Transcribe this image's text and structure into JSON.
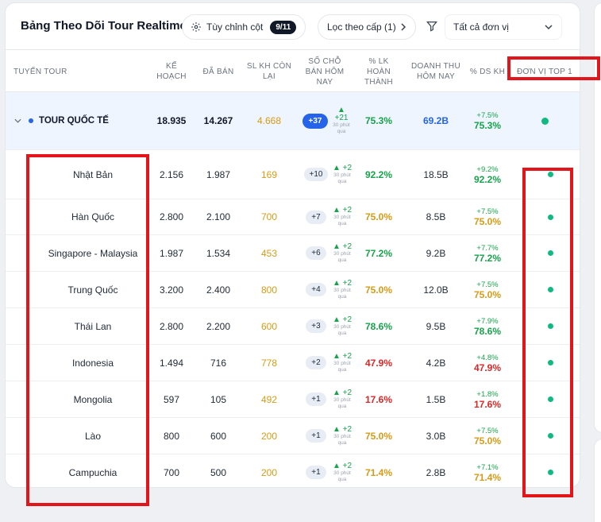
{
  "toolbar": {
    "title": "Bảng Theo Dõi Tour Realtime",
    "columns_button_label": "Tùy chỉnh cột",
    "columns_count": "9/11",
    "level_filter_label": "Lọc theo cấp (1)",
    "unit_select_value": "Tất cả đơn vị"
  },
  "columns": {
    "route": "TUYẾN TOUR",
    "plan": "KẾ HOẠCH",
    "sold": "ĐÃ BÁN",
    "remaining": "SL KH CÒN LẠI",
    "today": "SỐ CHỖ BÁN HÔM NAY",
    "completion": "% LK HOÀN THÀNH",
    "revenue": "DOANH THU HÔM NAY",
    "ds": "% DS KH",
    "top_unit": "ĐƠN VỊ TOP 1"
  },
  "total": {
    "name": "TOUR QUỐC TẾ",
    "plan": "18.935",
    "sold": "14.267",
    "remaining": "4.668",
    "today_pill": "+37",
    "today_delta": "+21",
    "today_sub": "30 phút qua",
    "completion": "75.3%",
    "revenue": "69.2B",
    "ds_delta": "+7.5%",
    "ds_pct": "75.3%"
  },
  "rows": [
    {
      "name": "Nhật Bản",
      "plan": "2.156",
      "sold": "1.987",
      "remaining": "169",
      "today_pill": "+10",
      "today_delta": "+2",
      "today_sub": "30 phút qua",
      "completion": "92.2%",
      "revenue": "18.5B",
      "ds_delta": "+9.2%",
      "ds_pct": "92.2%",
      "tone": "green"
    },
    {
      "name": "Hàn Quốc",
      "plan": "2.800",
      "sold": "2.100",
      "remaining": "700",
      "today_pill": "+7",
      "today_delta": "+2",
      "today_sub": "30 phút qua",
      "completion": "75.0%",
      "revenue": "8.5B",
      "ds_delta": "+7.5%",
      "ds_pct": "75.0%",
      "tone": "orange"
    },
    {
      "name": "Singapore - Malaysia",
      "plan": "1.987",
      "sold": "1.534",
      "remaining": "453",
      "today_pill": "+6",
      "today_delta": "+2",
      "today_sub": "30 phút qua",
      "completion": "77.2%",
      "revenue": "9.2B",
      "ds_delta": "+7.7%",
      "ds_pct": "77.2%",
      "tone": "green"
    },
    {
      "name": "Trung Quốc",
      "plan": "3.200",
      "sold": "2.400",
      "remaining": "800",
      "today_pill": "+4",
      "today_delta": "+2",
      "today_sub": "30 phút qua",
      "completion": "75.0%",
      "revenue": "12.0B",
      "ds_delta": "+7.5%",
      "ds_pct": "75.0%",
      "tone": "orange"
    },
    {
      "name": "Thái Lan",
      "plan": "2.800",
      "sold": "2.200",
      "remaining": "600",
      "today_pill": "+3",
      "today_delta": "+2",
      "today_sub": "30 phút qua",
      "completion": "78.6%",
      "revenue": "9.5B",
      "ds_delta": "+7.9%",
      "ds_pct": "78.6%",
      "tone": "green"
    },
    {
      "name": "Indonesia",
      "plan": "1.494",
      "sold": "716",
      "remaining": "778",
      "today_pill": "+2",
      "today_delta": "+2",
      "today_sub": "30 phút qua",
      "completion": "47.9%",
      "revenue": "4.2B",
      "ds_delta": "+4.8%",
      "ds_pct": "47.9%",
      "tone": "red"
    },
    {
      "name": "Mongolia",
      "plan": "597",
      "sold": "105",
      "remaining": "492",
      "today_pill": "+1",
      "today_delta": "+2",
      "today_sub": "30 phút qua",
      "completion": "17.6%",
      "revenue": "1.5B",
      "ds_delta": "+1.8%",
      "ds_pct": "17.6%",
      "tone": "red"
    },
    {
      "name": "Lào",
      "plan": "800",
      "sold": "600",
      "remaining": "200",
      "today_pill": "+1",
      "today_delta": "+2",
      "today_sub": "30 phút qua",
      "completion": "75.0%",
      "revenue": "3.0B",
      "ds_delta": "+7.5%",
      "ds_pct": "75.0%",
      "tone": "orange"
    },
    {
      "name": "Campuchia",
      "plan": "700",
      "sold": "500",
      "remaining": "200",
      "today_pill": "+1",
      "today_delta": "+2",
      "today_sub": "30 phút qua",
      "completion": "71.4%",
      "revenue": "2.8B",
      "ds_delta": "+7.1%",
      "ds_pct": "71.4%",
      "tone": "orange"
    }
  ],
  "colors": {
    "accent_blue": "#2563eb",
    "good_green": "#16a34a",
    "warn_orange": "#d89a14",
    "bad_red": "#dc2626",
    "status_dot": "#10b981",
    "highlight_red": "#e3151b"
  }
}
